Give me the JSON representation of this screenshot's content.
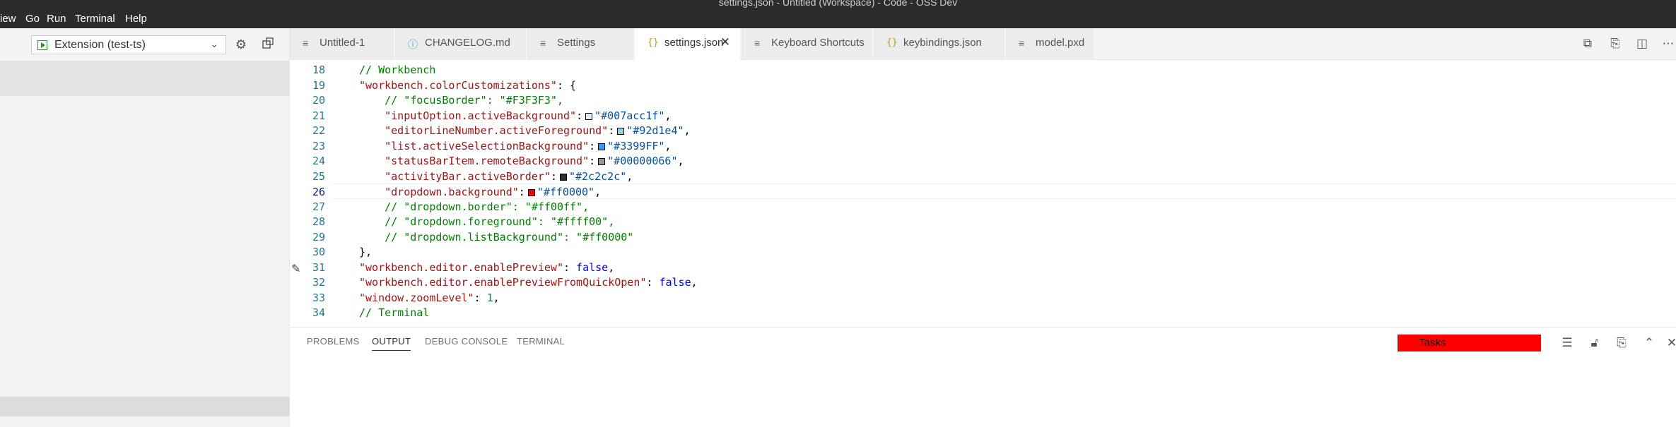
{
  "window": {
    "title": "settings.json - Untitled (Workspace) - Code - OSS Dev"
  },
  "menu": [
    "iew",
    "Go",
    "Run",
    "Terminal",
    "Help"
  ],
  "sidebar": {
    "launch_config": "Extension (test-ts)"
  },
  "tabs": [
    {
      "label": "Untitled-1",
      "icon": "file-icon"
    },
    {
      "label": "CHANGELOG.md",
      "icon": "markdown-icon"
    },
    {
      "label": "Settings",
      "icon": "file-icon"
    },
    {
      "label": "settings.json",
      "icon": "json-braces-icon",
      "active": true
    },
    {
      "label": "Keyboard Shortcuts",
      "icon": "file-icon"
    },
    {
      "label": "keybindings.json",
      "icon": "json-braces-icon"
    },
    {
      "label": "model.pxd",
      "icon": "file-icon"
    }
  ],
  "json_brace_glyph": "{}",
  "editor": {
    "line_numbers": [
      "18",
      "19",
      "20",
      "21",
      "22",
      "23",
      "24",
      "25",
      "26",
      "27",
      "28",
      "29",
      "30",
      "31",
      "32",
      "33",
      "34"
    ],
    "lines": {
      "l18": "// Workbench",
      "l19_key": "\"workbench.colorCustomizations\"",
      "l19_rest": ": {",
      "l20": "// \"focusBorder\": \"#F3F3F3\",",
      "l21_key": "\"inputOption.activeBackground\"",
      "l21_val": "\"#007acc1f\"",
      "l22_key": "\"editorLineNumber.activeForeground\"",
      "l22_val": "\"#92d1e4\"",
      "l23_key": "\"list.activeSelectionBackground\"",
      "l23_val": "\"#3399FF\"",
      "l24_key": "\"statusBarItem.remoteBackground\"",
      "l24_val": "\"#00000066\"",
      "l25_key": "\"activityBar.activeBorder\"",
      "l25_val": "\"#2c2c2c\"",
      "l26_key": "\"dropdown.background\"",
      "l26_val": "\"#ff0000\"",
      "l27": "// \"dropdown.border\": \"#ff00ff\",",
      "l28": "// \"dropdown.foreground\": \"#ffff00\",",
      "l29": "// \"dropdown.listBackground\": \"#ff0000\"",
      "l30": "},",
      "l31_key": "\"workbench.editor.enablePreview\"",
      "l31_val": "false",
      "l32_key": "\"workbench.editor.enablePreviewFromQuickOpen\"",
      "l32_val": "false",
      "l33_key": "\"window.zoomLevel\"",
      "l33_val": "1",
      "l34": "// Terminal"
    },
    "swatch_colors": {
      "l21": "#007acc1f",
      "l22": "#92d1e4",
      "l23": "#3399FF",
      "l24": "#00000066",
      "l25": "#2c2c2c",
      "l26": "#ff0000"
    }
  },
  "panel": {
    "tabs": [
      "PROBLEMS",
      "OUTPUT",
      "DEBUG CONSOLE",
      "TERMINAL"
    ],
    "active_tab": "OUTPUT",
    "task_select": "Tasks"
  },
  "colors": {
    "title_bar": "#2c2c2c",
    "accent_red": "#ff0000",
    "line_number": "#237893",
    "active_line_number": "#0b216f"
  }
}
